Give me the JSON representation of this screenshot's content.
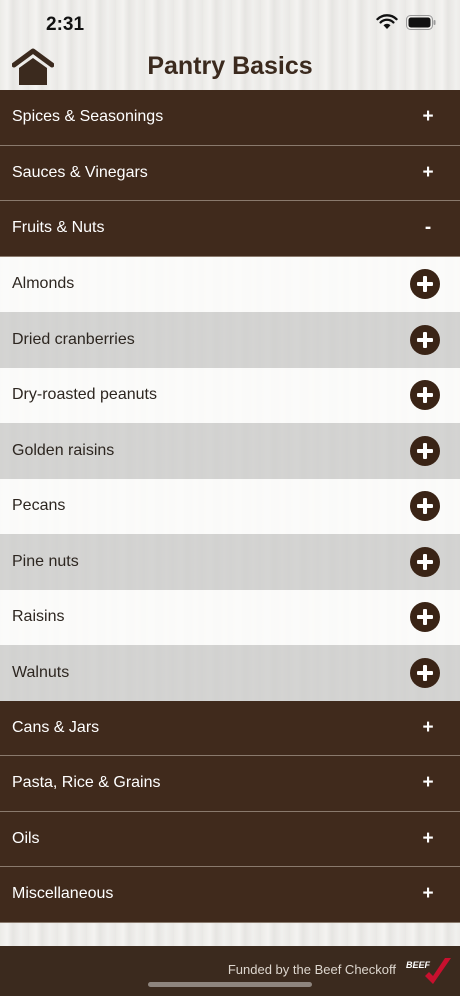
{
  "status": {
    "time": "2:31"
  },
  "header": {
    "title": "Pantry Basics",
    "home_icon": "home-icon"
  },
  "categories_before": [
    {
      "label": "Spices & Seasonings",
      "sign": "+"
    },
    {
      "label": "Sauces & Vinegars",
      "sign": "+"
    },
    {
      "label": "Fruits & Nuts",
      "sign": "-"
    }
  ],
  "items": [
    {
      "label": "Almonds"
    },
    {
      "label": "Dried cranberries"
    },
    {
      "label": "Dry-roasted peanuts"
    },
    {
      "label": "Golden raisins"
    },
    {
      "label": "Pecans"
    },
    {
      "label": "Pine nuts"
    },
    {
      "label": "Raisins"
    },
    {
      "label": "Walnuts"
    }
  ],
  "categories_after": [
    {
      "label": "Cans & Jars",
      "sign": "+"
    },
    {
      "label": "Pasta, Rice & Grains",
      "sign": "+"
    },
    {
      "label": "Oils",
      "sign": "+"
    },
    {
      "label": "Miscellaneous",
      "sign": "+"
    }
  ],
  "footer": {
    "text": "Funded by the Beef Checkoff",
    "logo_text": "BEEF"
  },
  "colors": {
    "brand_brown": "#402a1c",
    "logo_red": "#c8102e"
  }
}
